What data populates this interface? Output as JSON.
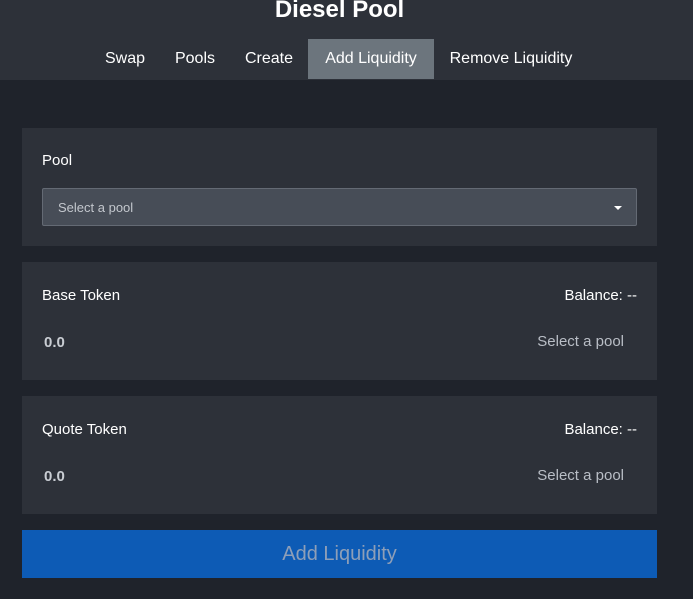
{
  "header": {
    "title": "Diesel Pool",
    "tabs": [
      {
        "label": "Swap"
      },
      {
        "label": "Pools"
      },
      {
        "label": "Create"
      },
      {
        "label": "Add Liquidity"
      },
      {
        "label": "Remove Liquidity"
      }
    ],
    "active_tab": "Add Liquidity"
  },
  "pool_card": {
    "label": "Pool",
    "select_value": "Select a pool"
  },
  "base_token": {
    "label": "Base Token",
    "balance": "Balance: --",
    "amount_placeholder": "0.0",
    "token_select": "Select a pool"
  },
  "quote_token": {
    "label": "Quote Token",
    "balance": "Balance: --",
    "amount_placeholder": "0.0",
    "token_select": "Select a pool"
  },
  "submit_label": "Add Liquidity",
  "colors": {
    "page_bg": "#1f232b",
    "card_bg": "#2d3139",
    "active_tab_bg": "#6c757d",
    "button_bg": "#0d5bb5"
  }
}
